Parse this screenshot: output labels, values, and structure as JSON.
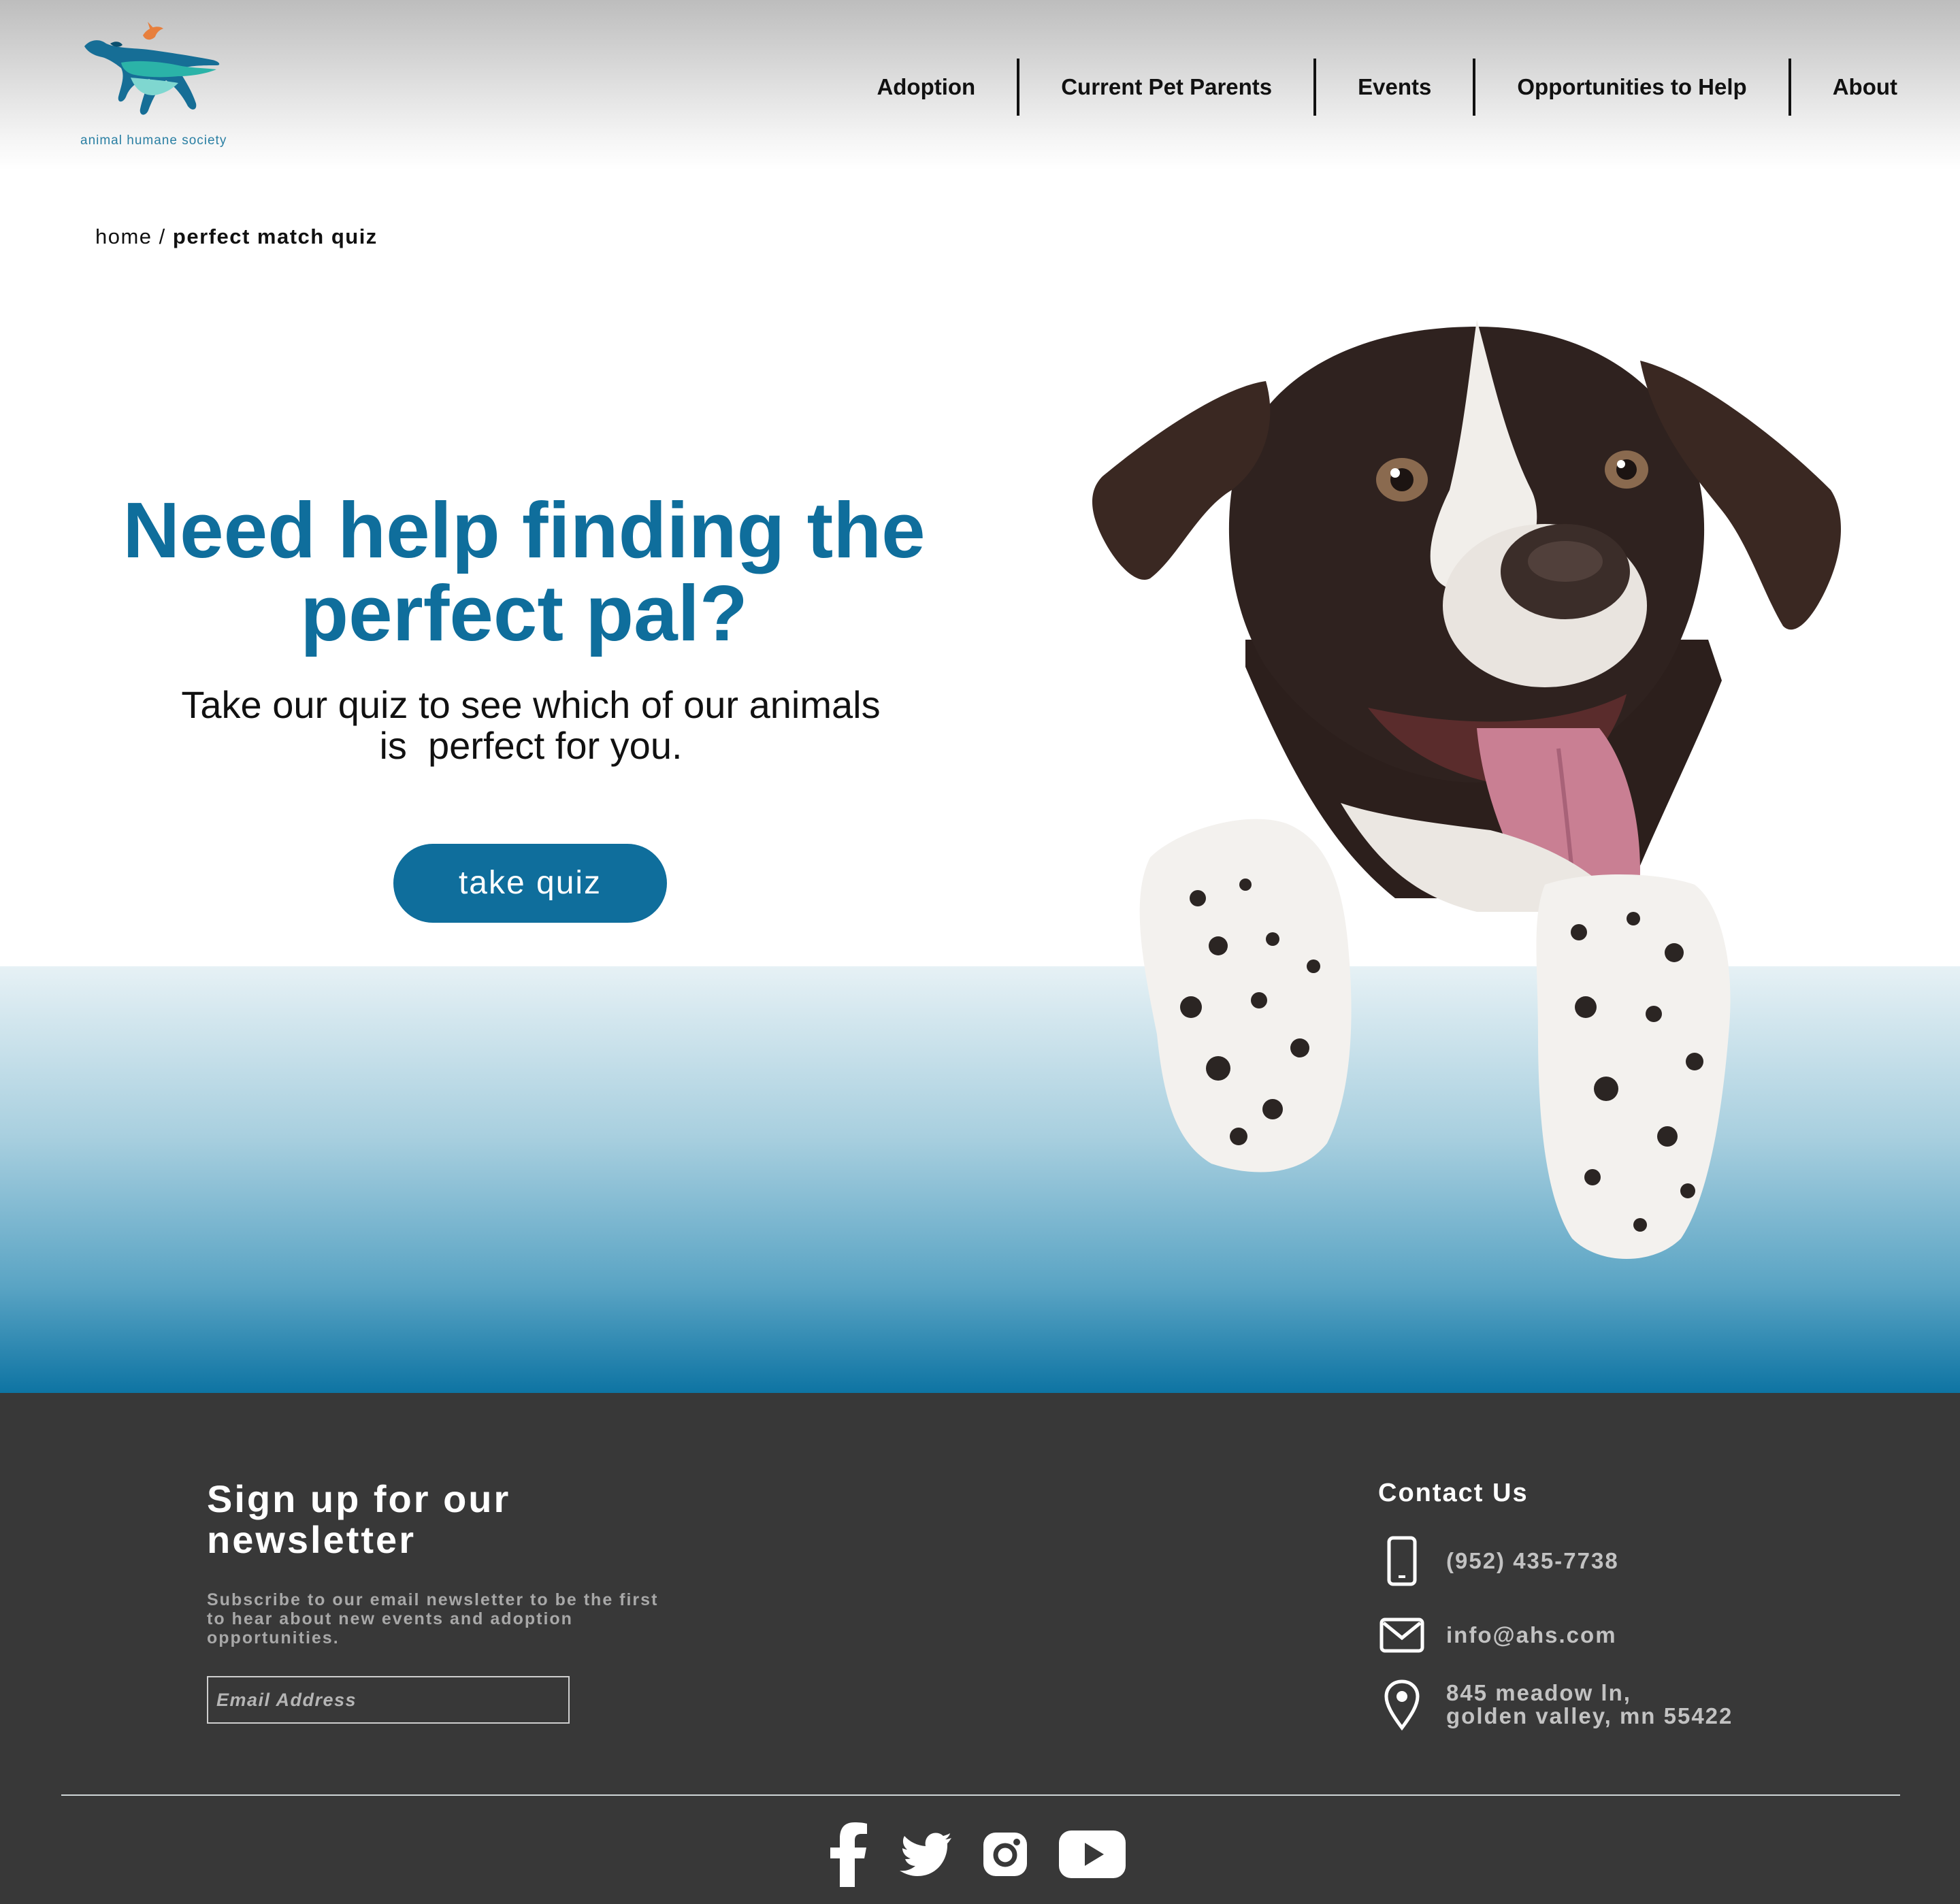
{
  "brand": {
    "name": "animal humane society",
    "accent": "#0f6e9c"
  },
  "nav": {
    "items": [
      "Adoption",
      "Current Pet Parents",
      "Events",
      "Opportunities to Help",
      "About"
    ]
  },
  "breadcrumb": {
    "home": "home",
    "separator": "/",
    "current": "perfect match quiz"
  },
  "hero": {
    "title_line1": "Need help finding the",
    "title_line2": "perfect pal?",
    "subtitle_line1": "Take our quiz to see which of our animals",
    "subtitle_line2": "is  perfect for you.",
    "cta_label": "take quiz"
  },
  "footer": {
    "newsletter": {
      "title_line1": "Sign up for our",
      "title_line2": "newsletter",
      "desc_line1": "Subscribe to our email newsletter to be the first",
      "desc_line2": "to hear about new events and adoption",
      "desc_line3": "opportunities.",
      "email_placeholder": "Email Address"
    },
    "contact": {
      "title": "Contact Us",
      "phone": "(952) 435-7738",
      "email": "info@ahs.com",
      "address_line1": "845 meadow ln,",
      "address_line2": "golden valley, mn 55422"
    },
    "social": [
      "facebook-icon",
      "twitter-icon",
      "instagram-icon",
      "youtube-icon"
    ]
  }
}
